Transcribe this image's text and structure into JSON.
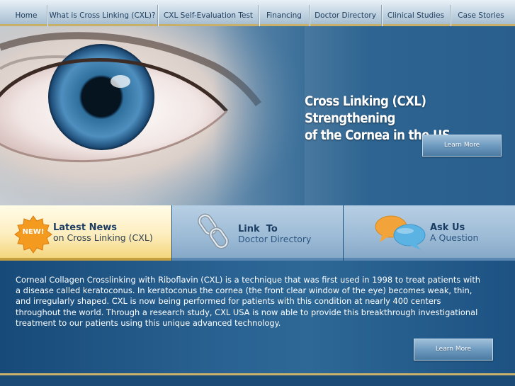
{
  "nav": {
    "items": [
      {
        "label": "Home"
      },
      {
        "label": "What is Cross Linking (CXL)?"
      },
      {
        "label": "CXL Self-Evaluation Test"
      },
      {
        "label": "Financing"
      },
      {
        "label": "Doctor Directory"
      },
      {
        "label": "Clinical Studies"
      },
      {
        "label": "Case Stories"
      }
    ]
  },
  "hero": {
    "title_line1": "Cross Linking (CXL) Strengthening",
    "title_line2": "of the Cornea in the US",
    "button_label": "Learn More"
  },
  "panels": {
    "news": {
      "badge": "NEW!",
      "title": "Latest News",
      "subtitle": "on Cross Linking (CXL)"
    },
    "directory": {
      "title": "Link  To",
      "subtitle": "Doctor Directory"
    },
    "ask": {
      "title": "Ask Us",
      "subtitle": "A Question"
    }
  },
  "content": {
    "paragraph": "Corneal Collagen Crosslinking with Riboflavin (CXL) is a technique that was first used in 1998 to treat patients with a disease called keratoconus. In keratoconus the cornea (the front clear window of the eye) becomes weak, thin, and irregularly shaped. CXL is now being performed for patients with this condition at nearly 400 centers throughout the world. Through a research study, CXL USA is now able to provide this breakthrough investigational treatment to our patients using this unique advanced technology.",
    "button_label": "Learn More"
  },
  "icons": {
    "eye": "eye-image",
    "badge": "new-badge-icon",
    "chain": "chain-link-icon",
    "bubbles": "speech-bubbles-icon"
  },
  "colors": {
    "accent_gold": "#c9b06a",
    "background_blue": "#1a4f7c",
    "nav_text": "#1d3d5e"
  }
}
